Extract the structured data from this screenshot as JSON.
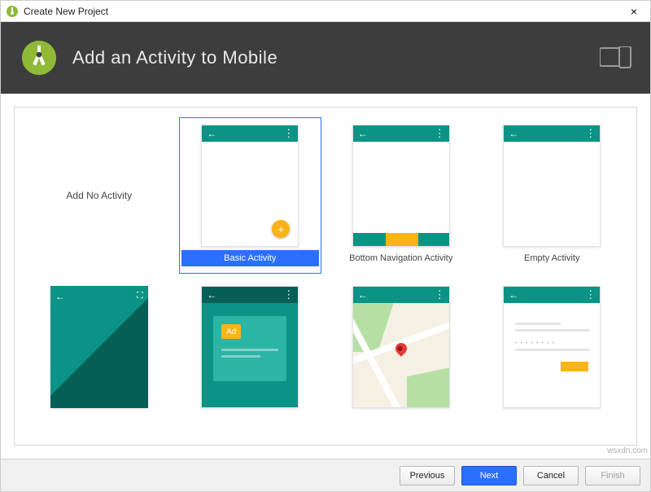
{
  "window": {
    "title": "Create New Project",
    "close_label": "×"
  },
  "banner": {
    "title": "Add an Activity to Mobile"
  },
  "templates": [
    {
      "label": "Add No Activity"
    },
    {
      "label": "Basic Activity",
      "selected": true
    },
    {
      "label": "Bottom Navigation Activity"
    },
    {
      "label": "Empty Activity"
    },
    {
      "label": ""
    },
    {
      "label": ""
    },
    {
      "label": ""
    },
    {
      "label": ""
    }
  ],
  "ad_label": "Ad",
  "buttons": {
    "previous": "Previous",
    "next": "Next",
    "cancel": "Cancel",
    "finish": "Finish"
  },
  "watermark": "wsxdn.com"
}
